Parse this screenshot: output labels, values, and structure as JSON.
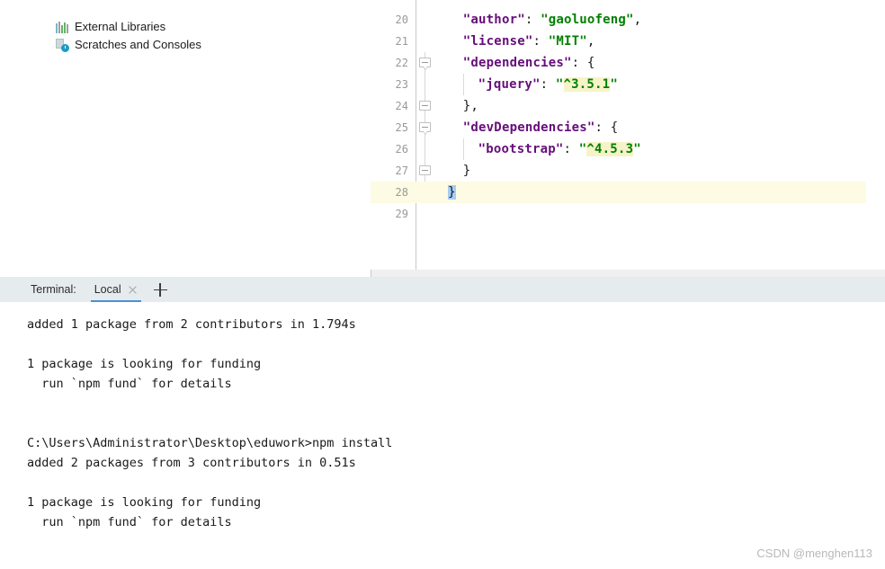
{
  "project_panel": {
    "nodes": [
      {
        "icon": "library-icon",
        "label": "External Libraries"
      },
      {
        "icon": "scratches-icon",
        "label": "Scratches and Consoles"
      }
    ]
  },
  "editor": {
    "language": "json",
    "first_visible_line": 20,
    "current_line": 28,
    "colors": {
      "key": "#660e7a",
      "string": "#008000",
      "punctuation": "#1a1a1a",
      "current_line_bg": "#fdfbe3",
      "version_highlight_bg": "#f7f3c8",
      "brace_match_bg": "#a5cdf5"
    },
    "lines": [
      {
        "number": "20",
        "indent": 1,
        "fold": null,
        "tokens": [
          {
            "t": "\"author\"",
            "c": "key"
          },
          {
            "t": ": ",
            "c": "punct"
          },
          {
            "t": "\"gaoluofeng\"",
            "c": "str"
          },
          {
            "t": ",",
            "c": "punct"
          }
        ]
      },
      {
        "number": "21",
        "indent": 1,
        "fold": null,
        "tokens": [
          {
            "t": "\"license\"",
            "c": "key"
          },
          {
            "t": ": ",
            "c": "punct"
          },
          {
            "t": "\"MIT\"",
            "c": "str"
          },
          {
            "t": ",",
            "c": "punct"
          }
        ]
      },
      {
        "number": "22",
        "indent": 1,
        "fold": "tip",
        "tokens": [
          {
            "t": "\"dependencies\"",
            "c": "key"
          },
          {
            "t": ": {",
            "c": "punct"
          }
        ]
      },
      {
        "number": "23",
        "indent": 2,
        "fold": null,
        "tokens": [
          {
            "t": "\"jquery\"",
            "c": "key"
          },
          {
            "t": ": ",
            "c": "punct"
          },
          {
            "t": "\"",
            "c": "str"
          },
          {
            "t": "^3.5.1",
            "c": "ver"
          },
          {
            "t": "\"",
            "c": "str"
          }
        ]
      },
      {
        "number": "24",
        "indent": 1,
        "fold": "box",
        "tokens": [
          {
            "t": "},",
            "c": "punct"
          }
        ]
      },
      {
        "number": "25",
        "indent": 1,
        "fold": "tip",
        "tokens": [
          {
            "t": "\"devDependencies\"",
            "c": "key"
          },
          {
            "t": ": {",
            "c": "punct"
          }
        ]
      },
      {
        "number": "26",
        "indent": 2,
        "fold": null,
        "tokens": [
          {
            "t": "\"bootstrap\"",
            "c": "key"
          },
          {
            "t": ": ",
            "c": "punct"
          },
          {
            "t": "\"",
            "c": "str"
          },
          {
            "t": "^4.5.3",
            "c": "ver"
          },
          {
            "t": "\"",
            "c": "str"
          }
        ]
      },
      {
        "number": "27",
        "indent": 1,
        "fold": "box",
        "tokens": [
          {
            "t": "}",
            "c": "punct"
          }
        ]
      },
      {
        "number": "28",
        "indent": 0,
        "fold": "box",
        "current": true,
        "tokens": [
          {
            "t": "}",
            "c": "brace-match"
          }
        ]
      },
      {
        "number": "29",
        "indent": 0,
        "fold": null,
        "tokens": []
      }
    ]
  },
  "terminal": {
    "label": "Terminal:",
    "tabs": [
      {
        "name": "Local",
        "active": true,
        "closable": true
      }
    ],
    "add_tab_label": "+",
    "output": [
      "added 1 package from 2 contributors in 1.794s",
      "",
      "1 package is looking for funding",
      "  run `npm fund` for details",
      "",
      "",
      "C:\\Users\\Administrator\\Desktop\\eduwork>npm install",
      "added 2 packages from 3 contributors in 0.51s",
      "",
      "1 package is looking for funding",
      "  run `npm fund` for details"
    ]
  },
  "watermark": {
    "text": "CSDN @menghen113"
  }
}
